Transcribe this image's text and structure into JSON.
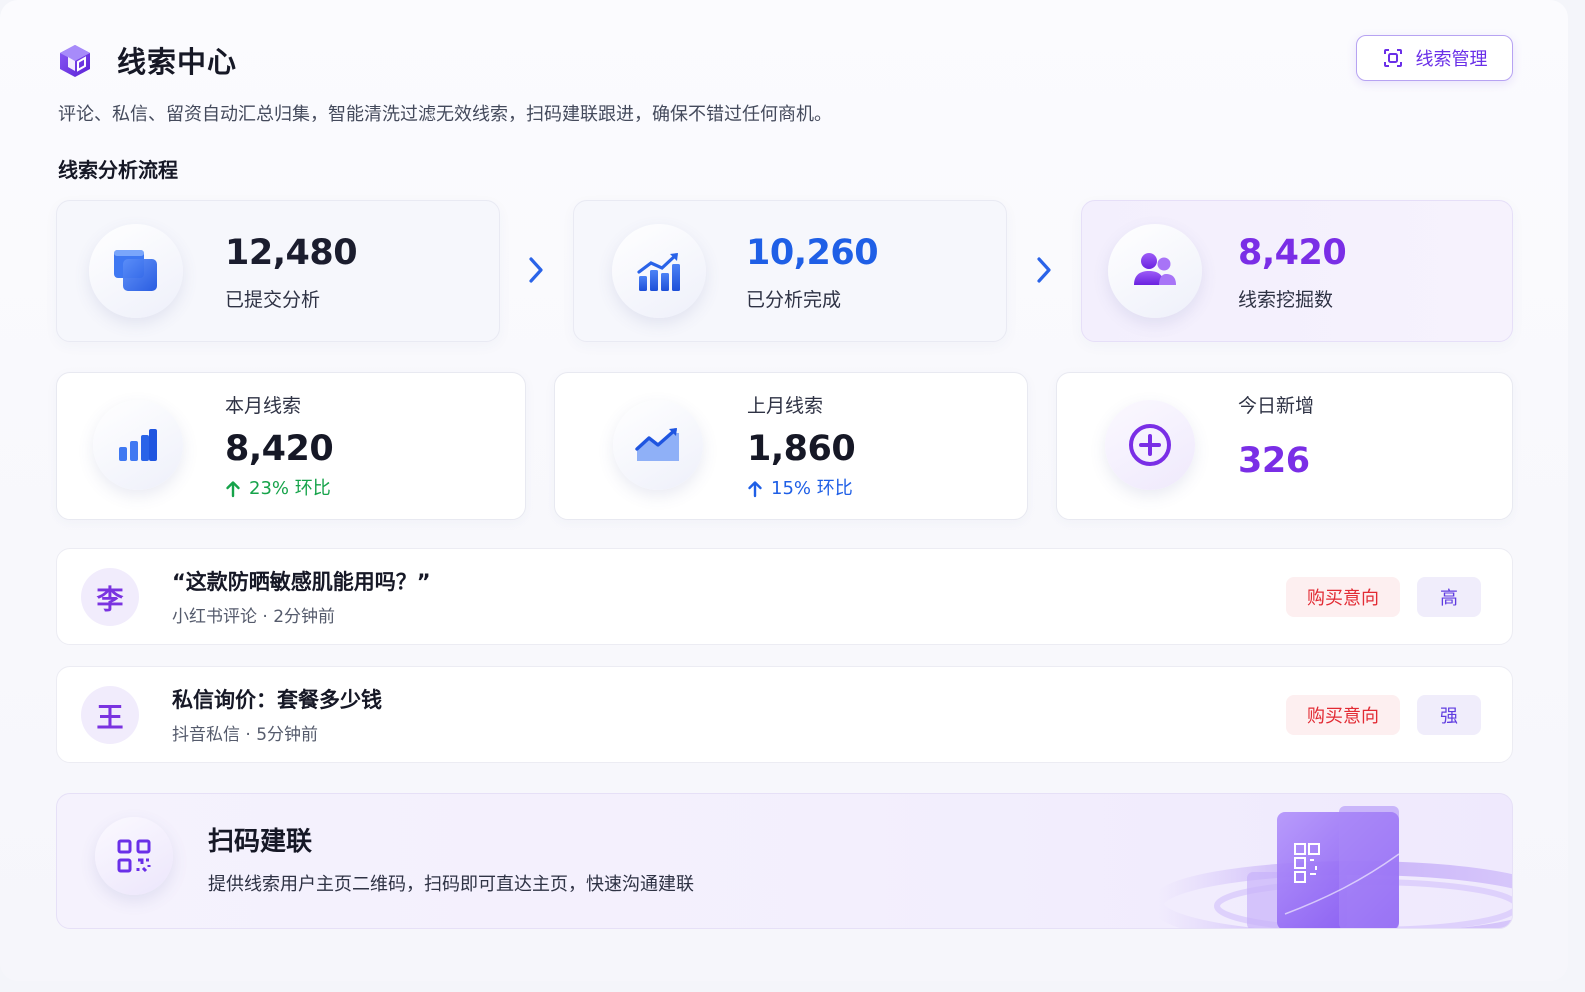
{
  "header": {
    "title": "线索中心",
    "manage_button": "线索管理",
    "subtitle": "评论、私信、留资自动汇总归集，智能清洗过滤无效线索，扫码建联跟进，确保不错过任何商机。",
    "section_title": "线索分析流程"
  },
  "flow": [
    {
      "value": "12,480",
      "label": "已提交分析",
      "icon": "layers-icon",
      "color": "#161826"
    },
    {
      "value": "10,260",
      "label": "已分析完成",
      "icon": "growth-chart-icon",
      "color": "#1f5fe6"
    },
    {
      "value": "8,420",
      "label": "线索挖掘数",
      "icon": "users-icon",
      "color": "#7a2ee6"
    }
  ],
  "stats": [
    {
      "label": "本月线索",
      "value": "8,420",
      "trend": "23% 环比",
      "trend_color": "#16a34a",
      "icon": "bar-chart-icon"
    },
    {
      "label": "上月线索",
      "value": "1,860",
      "trend": "15% 环比",
      "trend_color": "#1f5fe6",
      "icon": "line-chart-icon"
    },
    {
      "label": "今日新增",
      "value": "326",
      "icon": "plus-circle-icon",
      "value_color": "#7a2ee6"
    }
  ],
  "leads": [
    {
      "avatar": "李",
      "text": "“这款防晒敏感肌能用吗？”",
      "meta": "小红书评论 · 2分钟前",
      "intent": "购买意向",
      "level": "高"
    },
    {
      "avatar": "王",
      "text": "私信询价：套餐多少钱",
      "meta": "抖音私信 · 5分钟前",
      "intent": "购买意向",
      "level": "强"
    }
  ],
  "banner": {
    "title": "扫码建联",
    "description": "提供线索用户主页二维码，扫码即可直达主页，快速沟通建联"
  },
  "colors": {
    "brand_purple": "#6a2fe8",
    "brand_blue": "#1f5fe6",
    "positive_green": "#16a34a",
    "intent_red": "#e22a33"
  }
}
